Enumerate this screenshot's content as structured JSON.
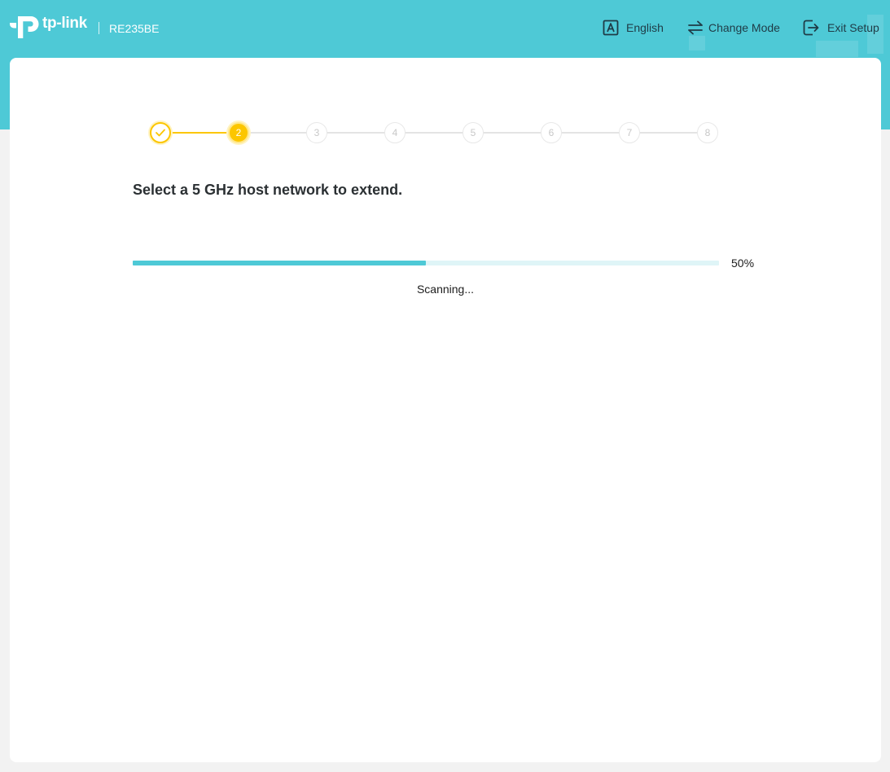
{
  "header": {
    "brand": "tp-link",
    "model": "RE235BE",
    "nav": [
      {
        "label": "English",
        "icon": "language-icon"
      },
      {
        "label": "Change Mode",
        "icon": "swap-arrows-icon"
      },
      {
        "label": "Exit Setup",
        "icon": "exit-icon"
      }
    ]
  },
  "wizard": {
    "steps": [
      {
        "label": "1",
        "state": "completed"
      },
      {
        "label": "2",
        "state": "active"
      },
      {
        "label": "3",
        "state": "pending"
      },
      {
        "label": "4",
        "state": "pending"
      },
      {
        "label": "5",
        "state": "pending"
      },
      {
        "label": "6",
        "state": "pending"
      },
      {
        "label": "7",
        "state": "pending"
      },
      {
        "label": "8",
        "state": "pending"
      }
    ],
    "heading": "Select a 5 GHz host network to extend.",
    "progress": {
      "value": 0.5,
      "percent_text": "50%",
      "status_text": "Scanning..."
    }
  },
  "colors": {
    "brand_teal": "#4ec9d6",
    "step_active": "#fcc600",
    "page_bg": "#f2f2f2",
    "progress_track": "#dff5f7"
  }
}
